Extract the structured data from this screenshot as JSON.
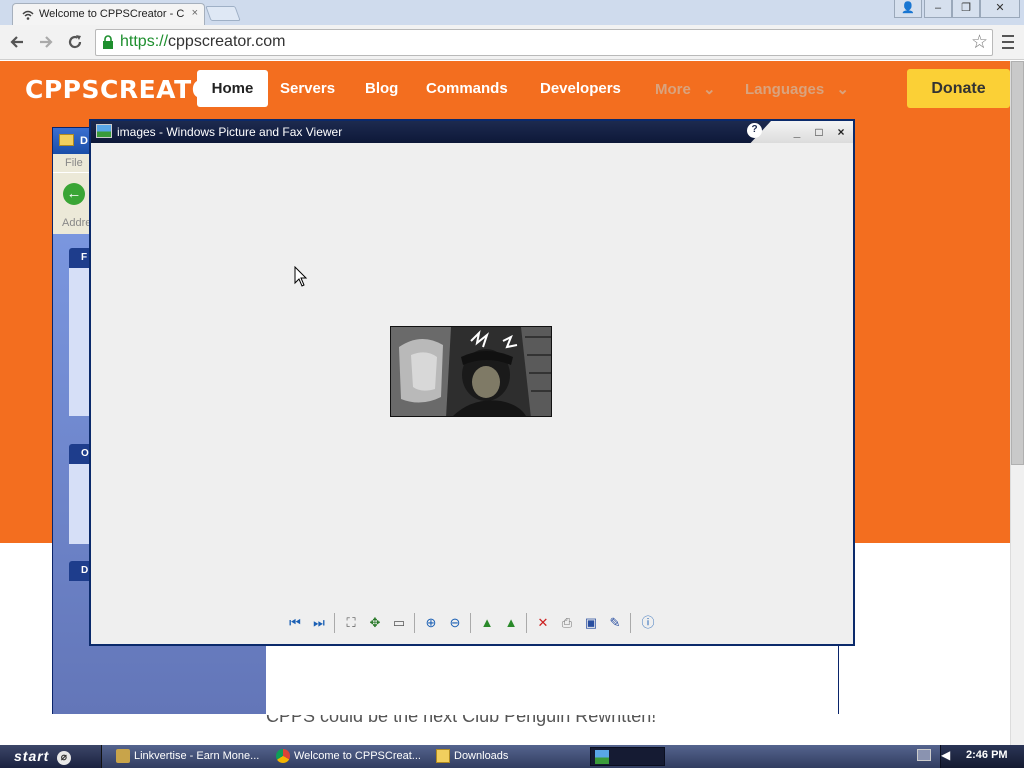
{
  "browser": {
    "tab_title": "Welcome to CPPSCreator - C",
    "tab_close": "×",
    "url_scheme": "https://",
    "url_host": "cppscreator.com",
    "window_controls": {
      "user": "👤",
      "minimize": "–",
      "restore": "❐",
      "close": "✕"
    }
  },
  "site": {
    "logo": "CPPSCREATOR",
    "nav": {
      "home": "Home",
      "servers": "Servers",
      "blog": "Blog",
      "commands": "Commands",
      "developers": "Developers",
      "more": "More",
      "languages": "Languages"
    },
    "donate": "Donate",
    "tagline": "CPPS could be the next Club Penguin Rewritten!"
  },
  "explorer": {
    "title": "D",
    "menu_file": "File",
    "address_label": "Addre",
    "panel1_head": "F",
    "panel2_head": "O",
    "panel3_head": "D"
  },
  "viewer": {
    "title": "images - Windows Picture and Fax Viewer",
    "help_round": "?",
    "minimize": "_",
    "maximize": "□",
    "close": "×"
  },
  "taskbar": {
    "start_label": "start",
    "items": [
      {
        "label": "Linkvertise - Earn Mone..."
      },
      {
        "label": "Welcome to CPPSCreat..."
      },
      {
        "label": "Downloads"
      }
    ],
    "clock": "2:46 PM"
  },
  "colors": {
    "site_orange": "#f36e1f",
    "donate_yellow": "#fbd036",
    "viewer_title_dark": "#1d2a4f"
  }
}
